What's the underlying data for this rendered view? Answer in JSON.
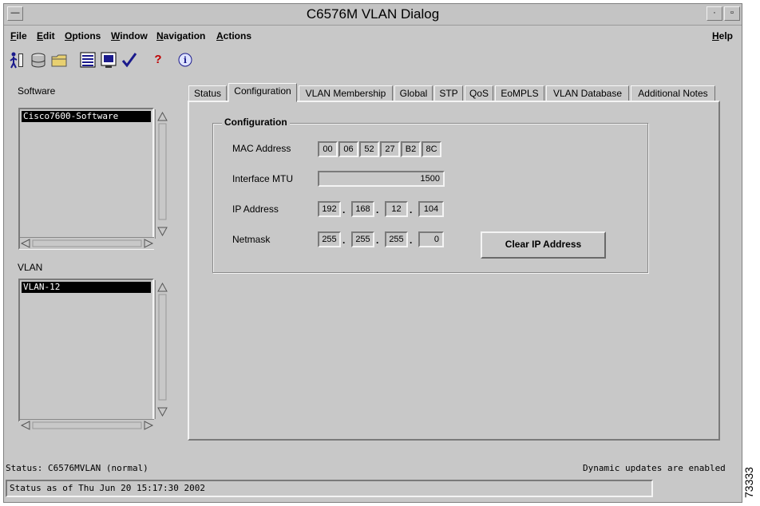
{
  "window": {
    "title": "C6576M VLAN Dialog",
    "minimize_glyph": "—",
    "restore_glyph": "▫"
  },
  "menu": {
    "file": "File",
    "edit": "Edit",
    "options": "Options",
    "window": "Window",
    "navigation": "Navigation",
    "actions": "Actions",
    "help": "Help"
  },
  "toolbar": {
    "icons": [
      "people-run-icon",
      "stack-icon",
      "folder-icon",
      "list-icon",
      "monitor-icon",
      "checkmark-icon",
      "help-icon",
      "info-icon"
    ],
    "help_glyph": "?",
    "info_glyph": "i"
  },
  "software": {
    "label": "Software",
    "items": [
      "Cisco7600-Software"
    ]
  },
  "vlan": {
    "label": "VLAN",
    "items": [
      "VLAN-12"
    ]
  },
  "tabs": [
    {
      "label": "Status",
      "active": false
    },
    {
      "label": "Configuration",
      "active": true
    },
    {
      "label": "VLAN Membership",
      "active": false
    },
    {
      "label": "Global",
      "active": false
    },
    {
      "label": "STP",
      "active": false
    },
    {
      "label": "QoS",
      "active": false
    },
    {
      "label": "EoMPLS",
      "active": false
    },
    {
      "label": "VLAN Database",
      "active": false
    },
    {
      "label": "Additional Notes",
      "active": false
    }
  ],
  "config": {
    "group_title": "Configuration",
    "mac_label": "MAC Address",
    "mac": [
      "00",
      "06",
      "52",
      "27",
      "B2",
      "8C"
    ],
    "mtu_label": "Interface MTU",
    "mtu": "1500",
    "ip_label": "IP Address",
    "ip": [
      "192",
      "168",
      "12",
      "104"
    ],
    "netmask_label": "Netmask",
    "netmask": [
      "255",
      "255",
      "255",
      "0"
    ],
    "clear_button": "Clear IP Address",
    "separator": "."
  },
  "status": {
    "left": "Status: C6576MVLAN (normal)",
    "right": "Dynamic updates are enabled",
    "box": "Status as of Thu Jun 20 15:17:30 2002"
  },
  "figure_code": "73333"
}
